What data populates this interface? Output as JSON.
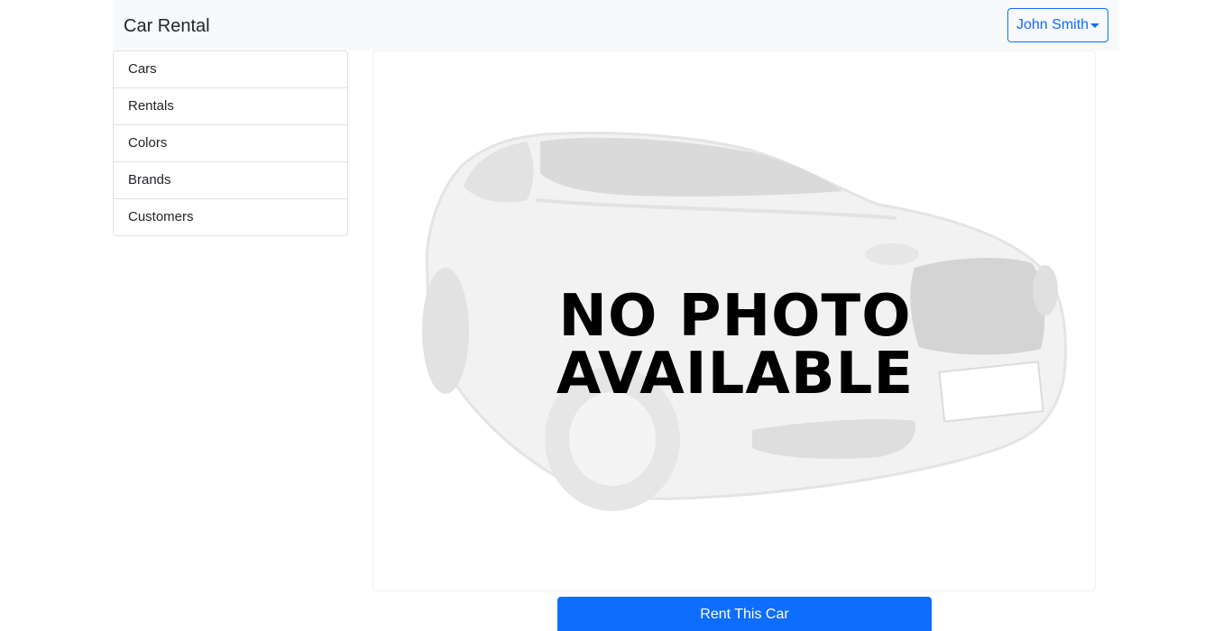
{
  "navbar": {
    "brand": "Car Rental",
    "user_menu_label": "John Smith"
  },
  "sidebar": {
    "items": [
      {
        "label": "Cars"
      },
      {
        "label": "Rentals"
      },
      {
        "label": "Colors"
      },
      {
        "label": "Brands"
      },
      {
        "label": "Customers"
      }
    ]
  },
  "photo": {
    "line1": "NO PHOTO",
    "line2": "AVAILABLE"
  },
  "actions": {
    "rent_label": "Rent This Car"
  },
  "colors": {
    "primary": "#0d6efd",
    "navbar_bg": "#f8f9fa",
    "border": "#dee2e6"
  }
}
